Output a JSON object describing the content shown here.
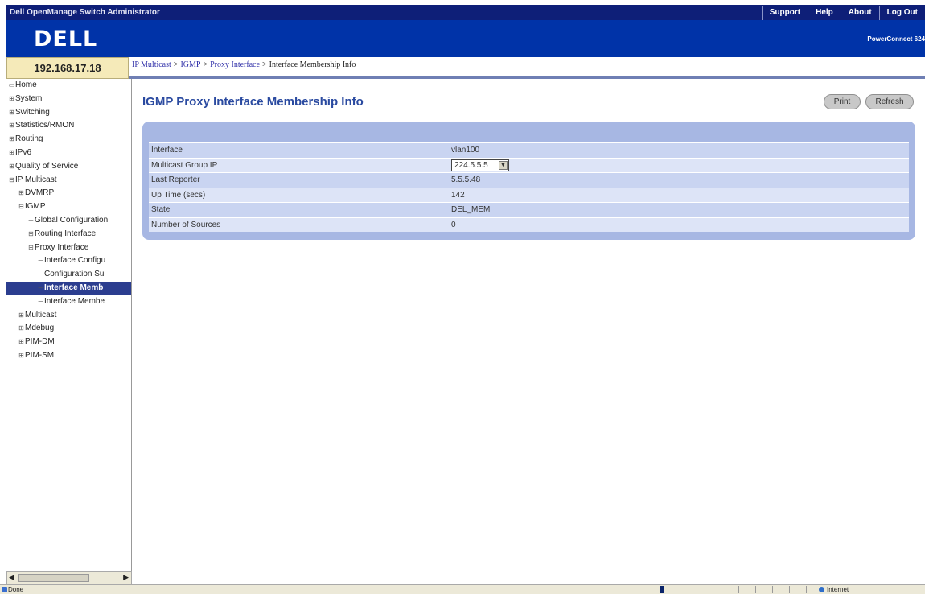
{
  "header": {
    "app_title": "Dell OpenManage Switch Administrator",
    "links": [
      "Support",
      "Help",
      "About",
      "Log Out"
    ],
    "logo": "DELL",
    "product": "PowerConnect 624"
  },
  "ip_address": "192.168.17.18",
  "breadcrumb": {
    "links": [
      "IP Multicast",
      "IGMP",
      "Proxy Interface"
    ],
    "current": "Interface Membership Info"
  },
  "sidebar": {
    "items": [
      {
        "label": "Home",
        "indent": 0,
        "exp": "▭"
      },
      {
        "label": "System",
        "indent": 0,
        "exp": "⊞"
      },
      {
        "label": "Switching",
        "indent": 0,
        "exp": "⊞"
      },
      {
        "label": "Statistics/RMON",
        "indent": 0,
        "exp": "⊞"
      },
      {
        "label": "Routing",
        "indent": 0,
        "exp": "⊞"
      },
      {
        "label": "IPv6",
        "indent": 0,
        "exp": "⊞"
      },
      {
        "label": "Quality of Service",
        "indent": 0,
        "exp": "⊞"
      },
      {
        "label": "IP Multicast",
        "indent": 0,
        "exp": "⊟"
      },
      {
        "label": "DVMRP",
        "indent": 1,
        "exp": "⊞"
      },
      {
        "label": "IGMP",
        "indent": 1,
        "exp": "⊟"
      },
      {
        "label": "Global Configuration",
        "indent": 2,
        "exp": ""
      },
      {
        "label": "Routing Interface",
        "indent": 2,
        "exp": "⊞"
      },
      {
        "label": "Proxy Interface",
        "indent": 2,
        "exp": "⊟"
      },
      {
        "label": "Interface Configu",
        "indent": 3,
        "exp": ""
      },
      {
        "label": "Configuration Su",
        "indent": 3,
        "exp": ""
      },
      {
        "label": "Interface Memb",
        "indent": 3,
        "exp": "",
        "selected": true
      },
      {
        "label": "Interface Membe",
        "indent": 3,
        "exp": ""
      },
      {
        "label": "Multicast",
        "indent": 1,
        "exp": "⊞"
      },
      {
        "label": "Mdebug",
        "indent": 1,
        "exp": "⊞"
      },
      {
        "label": "PIM-DM",
        "indent": 1,
        "exp": "⊞"
      },
      {
        "label": "PIM-SM",
        "indent": 1,
        "exp": "⊞"
      }
    ]
  },
  "main": {
    "title": "IGMP Proxy Interface Membership Info",
    "print_label": "Print",
    "refresh_label": "Refresh",
    "rows": [
      {
        "label": "Interface",
        "value": "vlan100"
      },
      {
        "label": "Multicast Group IP",
        "value": "224.5.5.5"
      },
      {
        "label": "Last Reporter",
        "value": "5.5.5.48"
      },
      {
        "label": "Up Time (secs)",
        "value": "142"
      },
      {
        "label": "State",
        "value": "DEL_MEM"
      },
      {
        "label": "Number of Sources",
        "value": "0"
      }
    ]
  },
  "statusbar": {
    "left": "Done",
    "zone": "Internet"
  }
}
